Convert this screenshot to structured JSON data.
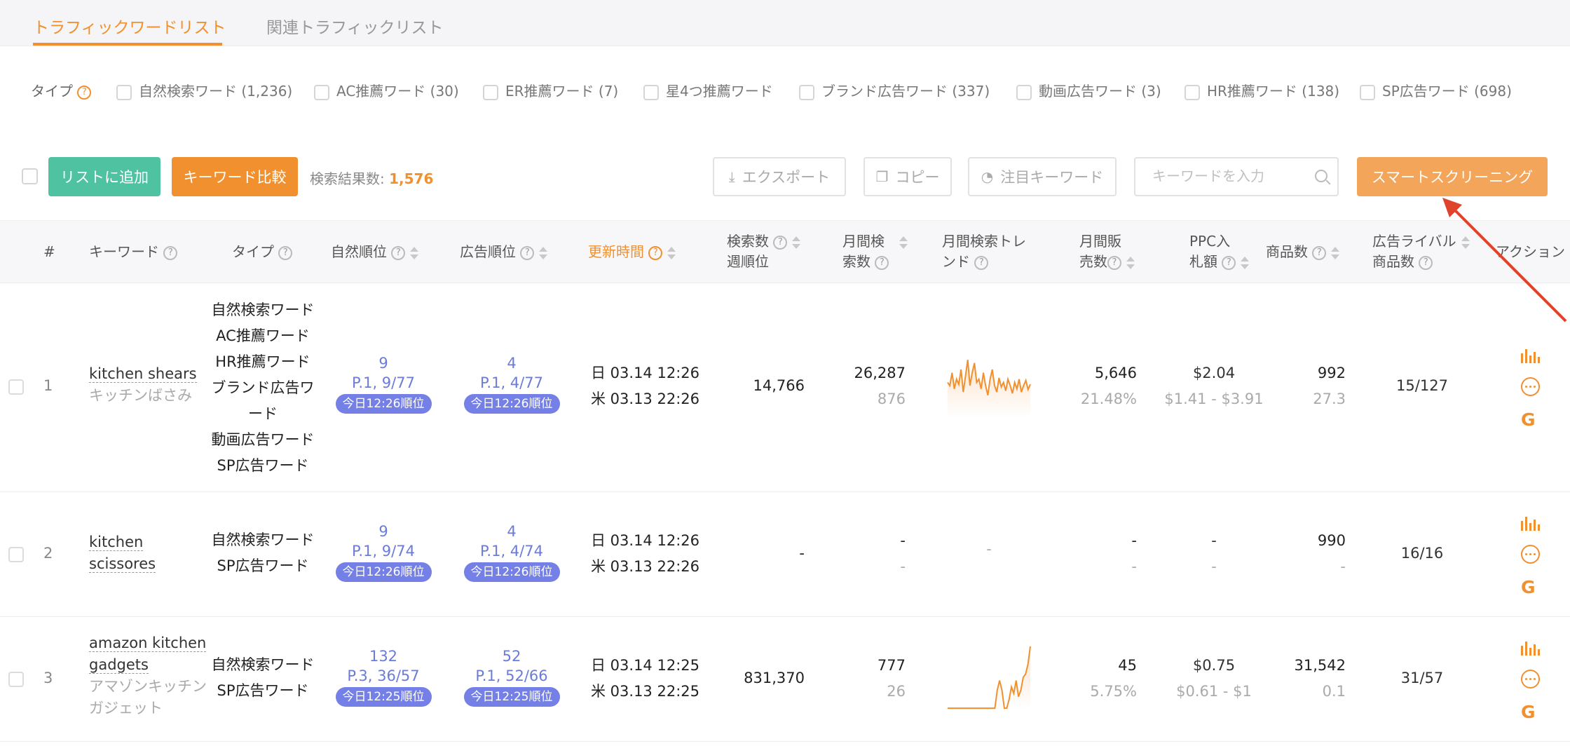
{
  "tabs": [
    {
      "label": "トラフィックワードリスト",
      "active": true
    },
    {
      "label": "関連トラフィックリスト",
      "active": false
    }
  ],
  "type_filter": {
    "label": "タイプ",
    "options": [
      "自然検索ワード (1,236)",
      "AC推薦ワード (30)",
      "ER推薦ワード (7)",
      "星4つ推薦ワード",
      "ブランド広告ワード (337)",
      "動画広告ワード (3)",
      "HR推薦ワード (138)",
      "SP広告ワード (698)"
    ]
  },
  "toolbar": {
    "add_to_list": "リストに追加",
    "compare": "キーワード比較",
    "result_label": "検索結果数:",
    "result_count": "1,576",
    "export": "エクスポート",
    "copy": "コピー",
    "watch": "注目キーワード",
    "search_placeholder": "キーワードを入力",
    "smart_screening": "スマートスクリーニング"
  },
  "columns": {
    "index": "#",
    "keyword": "キーワード",
    "type": "タイプ",
    "organic_rank": "自然順位",
    "ad_rank": "広告順位",
    "updated": "更新時間",
    "weekly_rank_1": "検索数",
    "weekly_rank_2": "週順位",
    "monthly_search_1": "月間検",
    "monthly_search_2": "索数",
    "trend_1": "月間検索トレ",
    "trend_2": "ンド",
    "monthly_sales_1": "月間販",
    "monthly_sales_2": "売数",
    "ppc_1": "PPC入",
    "ppc_2": "札額",
    "products": "商品数",
    "rival_1": "広告ライバル",
    "rival_2": "商品数",
    "action": "アクション"
  },
  "rows": [
    {
      "index": "1",
      "keyword": "kitchen shears",
      "keyword_jp": "キッチンばさみ",
      "types": [
        "自然検索ワード",
        "AC推薦ワード",
        "HR推薦ワード",
        "ブランド広告ワ",
        "ード",
        "動画広告ワード",
        "SP広告ワード"
      ],
      "organic_rank": "9",
      "organic_page": "P.1, 9/77",
      "organic_badge": "今日12:26順位",
      "ad_rank": "4",
      "ad_page": "P.1, 4/77",
      "ad_badge": "今日12:26順位",
      "time_jp": "日 03.14 12:26",
      "time_us": "米 03.13 22:26",
      "weekly_rank": "14,766",
      "monthly_search": "26,287",
      "monthly_search_sub": "876",
      "trend": [
        0.55,
        0.5,
        0.7,
        0.45,
        0.6,
        0.52,
        0.75,
        0.4,
        0.65,
        0.9,
        0.5,
        0.7,
        0.85,
        0.55,
        0.6,
        0.45,
        0.7,
        0.5,
        0.35,
        0.6,
        0.75,
        0.5,
        0.4,
        0.62,
        0.48,
        0.55,
        0.42,
        0.6,
        0.5,
        0.38,
        0.55,
        0.45,
        0.6,
        0.4,
        0.5,
        0.58,
        0.44,
        0.52
      ],
      "monthly_sales": "5,646",
      "monthly_sales_sub": "21.48%",
      "ppc": "$2.04",
      "ppc_range": "$1.41 - $3.91",
      "products": "992",
      "products_sub": "27.3",
      "rivals": "15/127"
    },
    {
      "index": "2",
      "keyword": "kitchen",
      "keyword_2": "scissores",
      "types": [
        "自然検索ワード",
        "SP広告ワード"
      ],
      "organic_rank": "9",
      "organic_page": "P.1, 9/74",
      "organic_badge": "今日12:26順位",
      "ad_rank": "4",
      "ad_page": "P.1, 4/74",
      "ad_badge": "今日12:26順位",
      "time_jp": "日 03.14 12:26",
      "time_us": "米 03.13 22:26",
      "weekly_rank": "-",
      "monthly_search": "-",
      "monthly_search_sub": "-",
      "trend_text": "-",
      "monthly_sales": "-",
      "monthly_sales_sub": "-",
      "ppc": "-",
      "ppc_range": "-",
      "products": "990",
      "products_sub": "-",
      "rivals": "16/16"
    },
    {
      "index": "3",
      "keyword": "amazon kitchen",
      "keyword_2": "gadgets",
      "keyword_jp": "アマゾンキッチン",
      "keyword_jp_2": "ガジェット",
      "types": [
        "自然検索ワード",
        "SP広告ワード"
      ],
      "organic_rank": "132",
      "organic_page": "P.3, 36/57",
      "organic_badge": "今日12:25順位",
      "ad_rank": "52",
      "ad_page": "P.1, 52/66",
      "ad_badge": "今日12:25順位",
      "time_jp": "日 03.14 12:25",
      "time_us": "米 03.13 22:25",
      "weekly_rank": "831,370",
      "monthly_search": "777",
      "monthly_search_sub": "26",
      "trend": [
        0.02,
        0.02,
        0.02,
        0.02,
        0.02,
        0.02,
        0.02,
        0.02,
        0.02,
        0.02,
        0.02,
        0.02,
        0.02,
        0.02,
        0.02,
        0.02,
        0.02,
        0.02,
        0.02,
        0.02,
        0.02,
        0.3,
        0.45,
        0.3,
        0.02,
        0.02,
        0.15,
        0.35,
        0.25,
        0.45,
        0.2,
        0.3,
        0.5,
        0.55,
        0.7,
        0.98
      ],
      "monthly_sales": "45",
      "monthly_sales_sub": "5.75%",
      "ppc": "$0.75",
      "ppc_range": "$0.61 - $1",
      "products": "31,542",
      "products_sub": "0.1",
      "rivals": "31/57"
    }
  ],
  "colors": {
    "accent": "#f0902f",
    "green": "#4fc3a1",
    "badge": "#7580e6",
    "rank_text": "#6b7bd8",
    "arrow": "#e0432b"
  },
  "icons": [
    "help-icon",
    "download-icon",
    "copy-icon",
    "pie-chart-icon",
    "search-icon",
    "bar-chart-icon",
    "more-icon",
    "google-icon",
    "sort-icon"
  ]
}
